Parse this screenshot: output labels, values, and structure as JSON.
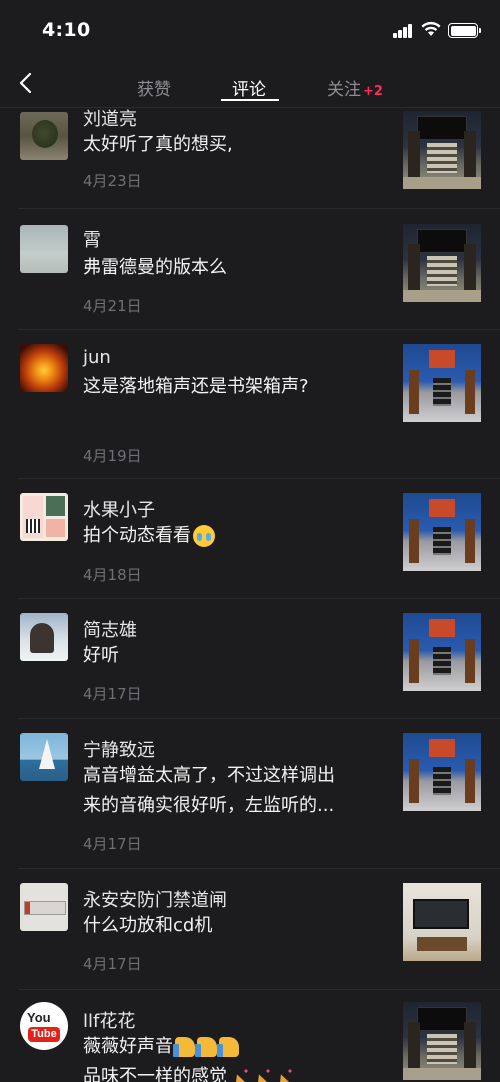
{
  "status_bar": {
    "time": "4:10"
  },
  "nav": {
    "tabs": [
      {
        "label": "获赞"
      },
      {
        "label": "评论"
      },
      {
        "label": "关注",
        "badge": "+2"
      }
    ]
  },
  "comments": [
    {
      "name": "刘道亮",
      "lines": [
        "太好听了真的想买,"
      ],
      "date": "4月23日",
      "avatar": "tree-photo",
      "thumb": "audio-room"
    },
    {
      "name": "霄",
      "lines": [
        "弗雷德曼的版本么"
      ],
      "date": "4月21日",
      "avatar": "sky-photo",
      "thumb": "audio-room"
    },
    {
      "name": "jun",
      "lines": [
        "这是落地箱声还是书架箱声?"
      ],
      "date": "4月19日",
      "avatar": "fire-photo",
      "thumb": "audio-show"
    },
    {
      "name": "水果小子",
      "lines": [
        "拍个动态看看"
      ],
      "date": "4月18日",
      "avatar": "qr-card",
      "thumb": "audio-show",
      "emoji": "crying-face"
    },
    {
      "name": "简志雄",
      "lines": [
        "好听"
      ],
      "date": "4月17日",
      "avatar": "snow-person",
      "thumb": "audio-show"
    },
    {
      "name": "宁静致远",
      "lines": [
        "高音增益太高了，不过这样调出",
        "来的音确实很好听，左监听的..."
      ],
      "date": "4月17日",
      "avatar": "sailboat",
      "thumb": "audio-show"
    },
    {
      "name": "永安安防门禁道闸",
      "lines": [
        "什么功放和cd机"
      ],
      "date": "4月17日",
      "avatar": "barrier-gate",
      "thumb": "tv-room"
    },
    {
      "name": "llf花花",
      "lines": [
        "薇薇好声音",
        "品味不一样的感觉"
      ],
      "date": "",
      "avatar": "youtube-logo",
      "thumb": "audio-room"
    }
  ],
  "avatar_logo": {
    "word": "You",
    "tube": "Tube"
  }
}
